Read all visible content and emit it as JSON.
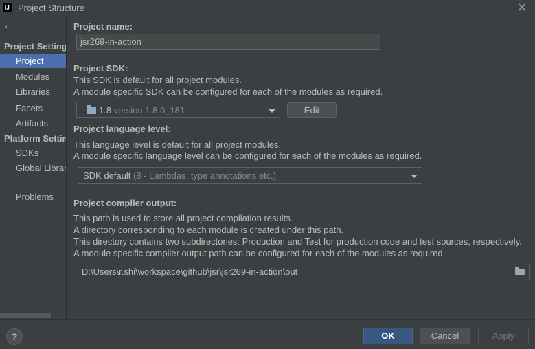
{
  "window": {
    "title": "Project Structure",
    "close_glyph": "✕",
    "app_icon_label": "IJ"
  },
  "nav": {
    "back_glyph": "←",
    "forward_glyph": "→"
  },
  "sidebar": {
    "project_settings_label": "Project Settings",
    "project_items": [
      {
        "label": "Project",
        "selected": true
      },
      {
        "label": "Modules"
      },
      {
        "label": "Libraries"
      },
      {
        "label": "Facets"
      },
      {
        "label": "Artifacts"
      }
    ],
    "platform_settings_label": "Platform Settings",
    "platform_items": [
      {
        "label": "SDKs"
      },
      {
        "label": "Global Libraries"
      }
    ],
    "problems_label": "Problems"
  },
  "main": {
    "project_name": {
      "heading": "Project name:",
      "value": "jsr269-in-action"
    },
    "sdk": {
      "heading": "Project SDK:",
      "desc1": "This SDK is default for all project modules.",
      "desc2": "A module specific SDK can be configured for each of the modules as required.",
      "selected_name": "1.8",
      "selected_version": "version 1.8.0_181",
      "edit_label": "Edit"
    },
    "language": {
      "heading": "Project language level:",
      "desc1": "This language level is default for all project modules.",
      "desc2": "A module specific language level can be configured for each of the modules as required.",
      "selected_name": "SDK default",
      "selected_detail": "(8 - Lambdas, type annotations etc.)"
    },
    "compiler": {
      "heading": "Project compiler output:",
      "desc1": "This path is used to store all project compilation results.",
      "desc2": "A directory corresponding to each module is created under this path.",
      "desc3": "This directory contains two subdirectories: Production and Test for production code and test sources, respectively.",
      "desc4": "A module specific compiler output path can be configured for each of the modules as required.",
      "path": "D:\\Users\\r.shi\\workspace\\github\\jsr\\jsr269-in-action\\out"
    }
  },
  "footer": {
    "help_label": "?",
    "ok_label": "OK",
    "cancel_label": "Cancel",
    "apply_label": "Apply"
  },
  "colors": {
    "background": "#3c3f41",
    "selection": "#4b6eaf",
    "ok_button": "#365880",
    "text": "#bbbbbb"
  }
}
